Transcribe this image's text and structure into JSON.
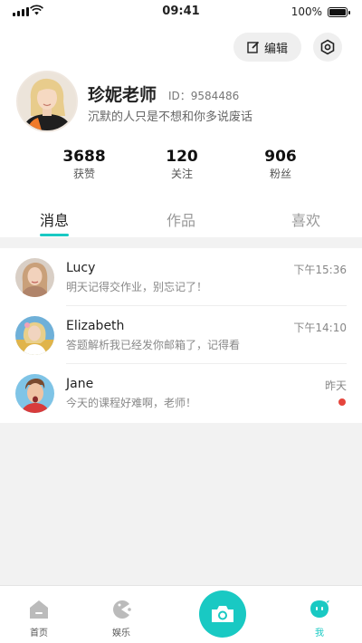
{
  "status_bar": {
    "time": "09:41",
    "battery": "100%"
  },
  "header": {
    "edit_label": "编辑"
  },
  "profile": {
    "name": "珍妮老师",
    "id_text": "ID：9584486",
    "bio": "沉默的人只是不想和你多说废话"
  },
  "stats": [
    {
      "value": "3688",
      "label": "获赞"
    },
    {
      "value": "120",
      "label": "关注"
    },
    {
      "value": "906",
      "label": "粉丝"
    }
  ],
  "tabs": [
    {
      "label": "消息",
      "active": true
    },
    {
      "label": "作品",
      "active": false
    },
    {
      "label": "喜欢",
      "active": false
    }
  ],
  "messages": [
    {
      "name": "Lucy",
      "text": "明天记得交作业，别忘记了！",
      "time": "下午15:36",
      "unread": false
    },
    {
      "name": "Elizabeth",
      "text": "答题解析我已经发你邮箱了，记得看",
      "time": "下午14:10",
      "unread": false
    },
    {
      "name": "Jane",
      "text": "今天的课程好难啊，老师！",
      "time": "昨天",
      "unread": true
    }
  ],
  "bottom_nav": [
    {
      "label": "首页",
      "icon": "home-icon"
    },
    {
      "label": "娱乐",
      "icon": "game-icon"
    },
    {
      "label": "",
      "icon": "camera-icon"
    },
    {
      "label": "我",
      "icon": "profile-icon"
    }
  ],
  "colors": {
    "accent": "#19c9c3",
    "unread_dot": "#e5453c",
    "background": "#f2f2f2"
  }
}
